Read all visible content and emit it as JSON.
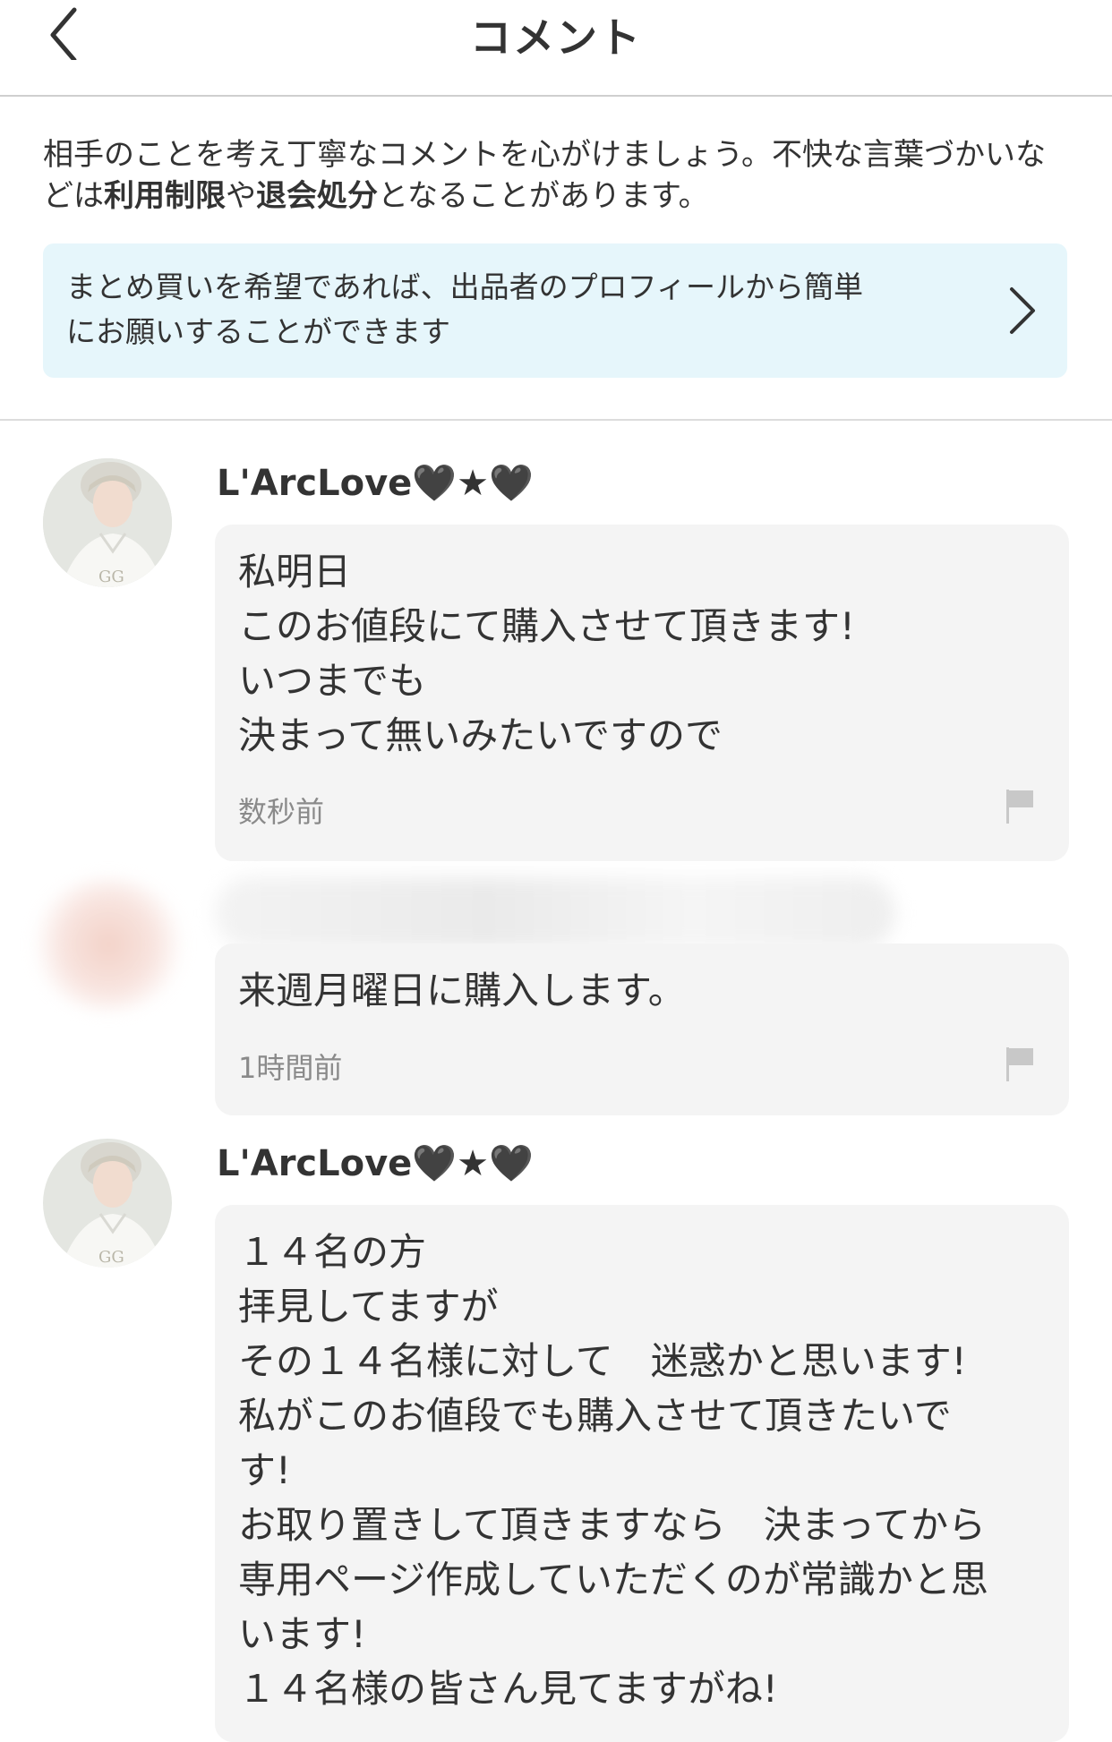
{
  "header": {
    "title": "コメント"
  },
  "notice": {
    "part1": "相手のことを考え丁寧なコメントを心がけましょう。不快な言葉づかいなどは",
    "bold1": "利用制限",
    "part2": "や",
    "bold2": "退会処分",
    "part3": "となることがあります。"
  },
  "info_card": {
    "line1": "まとめ買いを希望であれば、出品者のプロフィールから簡単",
    "line2": "にお願いすることができます"
  },
  "comments": [
    {
      "username": "L'ArcLove🖤★🖤",
      "message": "私明日\nこのお値段にて購入させて頂きます!\nいつまでも\n決まって無いみたいですので",
      "time": "数秒前"
    },
    {
      "message": "来週月曜日に購入します。",
      "time": "1時間前"
    },
    {
      "username": "L'ArcLove🖤★🖤",
      "message": "１４名の方\n拝見してますが\nその１４名様に対して　迷惑かと思います!\n私がこのお値段でも購入させて頂きたいで\nす!\nお取り置きして頂きますなら　決まってから\n専用ページ作成していただくのが常識かと思\nいます!\n１４名様の皆さん見てますがね!"
    }
  ],
  "colors": {
    "info_card_bg": "#e6f6fb",
    "bubble_bg": "#f4f4f4",
    "time_text": "#8a8a8a"
  }
}
